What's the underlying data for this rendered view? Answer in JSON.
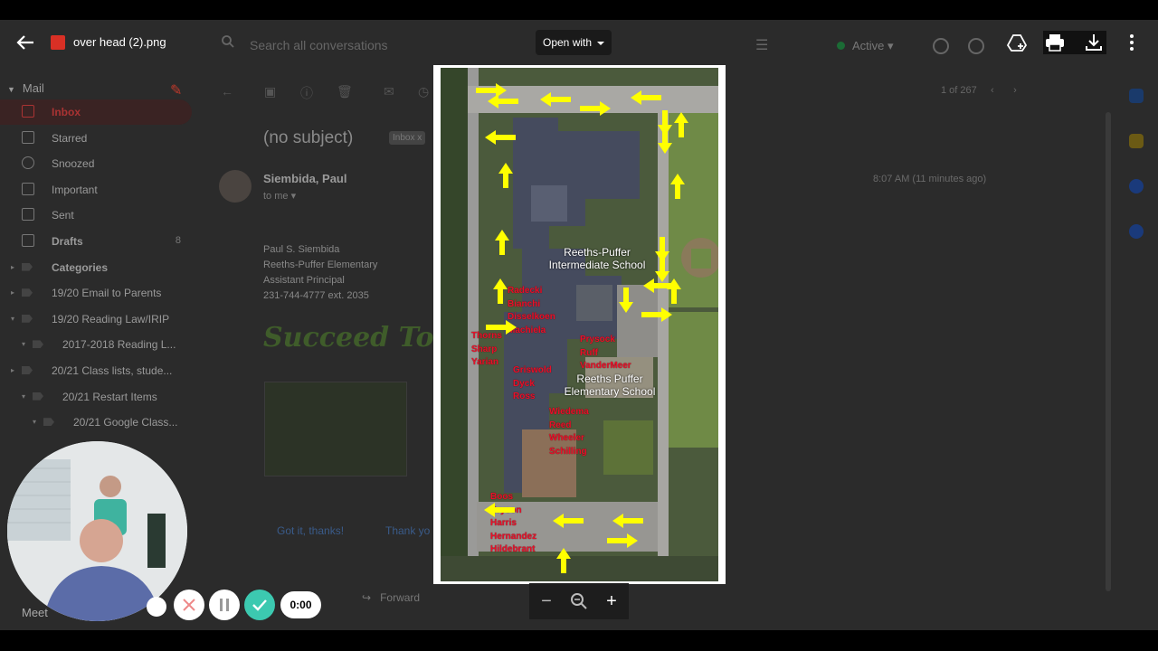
{
  "viewer": {
    "file_name": "over head (2).png",
    "open_with_label": "Open with",
    "icons": [
      "back-arrow-icon",
      "image-file-icon",
      "add-to-drive-icon",
      "print-icon",
      "download-icon",
      "more-vert-icon"
    ]
  },
  "gmail_background": {
    "search_placeholder": "Search all conversations",
    "status": "Active",
    "mail_section": "Mail",
    "sidebar": [
      {
        "label": "Inbox",
        "count": "",
        "icon": "inbox-icon",
        "bold": true
      },
      {
        "label": "Starred",
        "count": "",
        "icon": "star-icon",
        "bold": false
      },
      {
        "label": "Snoozed",
        "count": "",
        "icon": "clock-icon",
        "bold": false
      },
      {
        "label": "Important",
        "count": "",
        "icon": "important-icon",
        "bold": false
      },
      {
        "label": "Sent",
        "count": "",
        "icon": "send-icon",
        "bold": false
      },
      {
        "label": "Drafts",
        "count": "8",
        "icon": "draft-icon",
        "bold": true
      },
      {
        "label": "Categories",
        "count": "",
        "icon": "label-icon",
        "bold": true
      },
      {
        "label": "19/20 Email to Parents",
        "count": "",
        "icon": "label-icon",
        "bold": false
      },
      {
        "label": "19/20 Reading Law/IRIP",
        "count": "",
        "icon": "label-icon",
        "bold": false
      },
      {
        "label": "2017-2018 Reading L...",
        "count": "",
        "icon": "label-icon",
        "bold": false
      },
      {
        "label": "20/21 Class lists, stude...",
        "count": "",
        "icon": "label-icon",
        "bold": false
      },
      {
        "label": "20/21 Restart Items",
        "count": "",
        "icon": "label-icon",
        "bold": false
      },
      {
        "label": "20/21 Google Class...",
        "count": "",
        "icon": "label-icon",
        "bold": false
      }
    ],
    "meet_label": "Meet",
    "email": {
      "subject": "(no subject)",
      "label_chip": "Inbox x",
      "sender": "Siembida, Paul",
      "to": "to me",
      "time": "8:07 AM (11 minutes ago)",
      "pager": "1 of 267",
      "signature": [
        "Paul S. Siembida",
        "Reeths-Puffer Elementary",
        "Assistant Principal",
        "231-744-4777 ext. 2035"
      ],
      "banner_text": "Succeed Toda",
      "smart_replies": [
        "Got it, thanks!",
        "Thank yo"
      ],
      "forward_label": "Forward"
    }
  },
  "map_image": {
    "building_labels": [
      {
        "text": "Reeths-Puffer Intermediate School"
      },
      {
        "text": "Reeths Puffer Elementary School"
      }
    ],
    "teacher_groups": [
      {
        "names": [
          "Radecki",
          "Bianchi",
          "Disselkoen",
          "Machiela"
        ]
      },
      {
        "names": [
          "Thorns",
          "Sharp",
          "Yarian"
        ]
      },
      {
        "names": [
          "Prysock",
          "Ruff",
          "VanderMeer"
        ]
      },
      {
        "names": [
          "Griswold",
          "Dyck",
          "Ross"
        ]
      },
      {
        "names": [
          "Wiedema",
          "Reed",
          "Wheeler",
          "Schilling"
        ]
      },
      {
        "names": [
          "Boos",
          "Bryson",
          "Harris",
          "Hernandez",
          "Hildebrant"
        ]
      }
    ],
    "arrow_color": "#ffff00",
    "label_color": "#e8102a"
  },
  "zoom_controls": {
    "minus": "−",
    "plus": "+"
  },
  "recorder": {
    "time": "0:00",
    "icons": [
      "more-icon",
      "cancel-icon",
      "pause-icon",
      "done-icon"
    ]
  }
}
